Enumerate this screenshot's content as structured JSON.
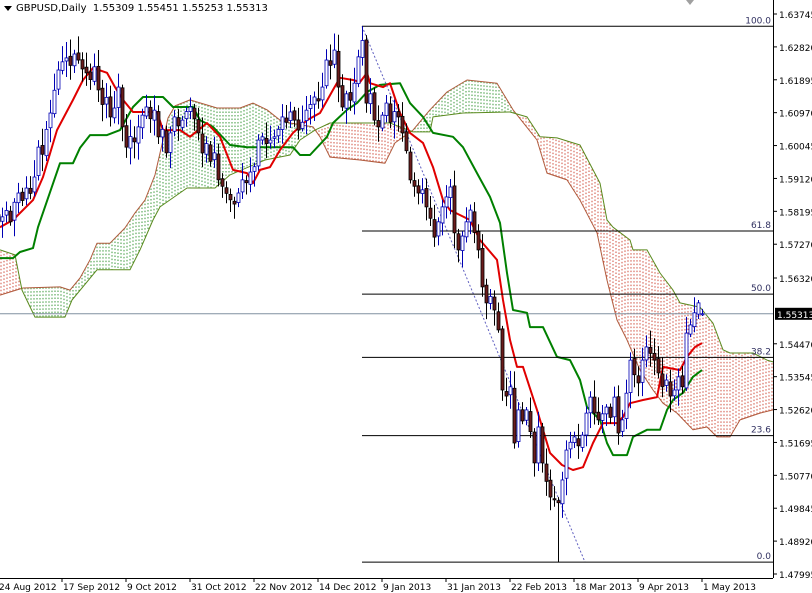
{
  "header": {
    "symbol": "GBPUSD,Daily",
    "open": "1.55309",
    "high": "1.55451",
    "low": "1.55253",
    "close": "1.55313"
  },
  "colors": {
    "bull_body": "#ffffff",
    "bull_line": "#0000b4",
    "bear_body": "#6b1c1c",
    "bear_line": "#000000",
    "tenkan": "#e00000",
    "kijun": "#008000",
    "cloud_bull": "#3c9a3c",
    "cloud_bear": "#d05040",
    "span_a": "#b05a3c",
    "span_b": "#5a8a1e",
    "fib": "#000000",
    "fib_trend": "#6060c0",
    "bid_line": "#8090a0"
  },
  "chart_data": {
    "type": "candlestick",
    "title": "GBPUSD,Daily",
    "ylim": [
      1.47995,
      1.63745
    ],
    "y_ticks": [
      "1.63745",
      "1.62820",
      "1.61895",
      "1.60970",
      "1.60045",
      "1.59120",
      "1.58195",
      "1.57270",
      "1.56320",
      "1.54470",
      "1.53545",
      "1.52620",
      "1.51695",
      "1.50770",
      "1.49845",
      "1.48920",
      "1.47995"
    ],
    "current_price": "1.55313",
    "x_ticks": [
      {
        "bar": 0,
        "label": "24 Aug 2012"
      },
      {
        "bar": 16,
        "label": "17 Sep 2012"
      },
      {
        "bar": 32,
        "label": "9 Oct 2012"
      },
      {
        "bar": 48,
        "label": "31 Oct 2012"
      },
      {
        "bar": 64,
        "label": "22 Nov 2012"
      },
      {
        "bar": 80,
        "label": "14 Dec 2012"
      },
      {
        "bar": 96,
        "label": "9 Jan 2013"
      },
      {
        "bar": 112,
        "label": "31 Jan 2013"
      },
      {
        "bar": 128,
        "label": "22 Feb 2013"
      },
      {
        "bar": 144,
        "label": "18 Mar 2013"
      },
      {
        "bar": 160,
        "label": "9 Apr 2013"
      },
      {
        "bar": 176,
        "label": "1 May 2013"
      }
    ],
    "closes": [
      1.579,
      1.5804,
      1.5822,
      1.579,
      1.5845,
      1.5871,
      1.585,
      1.5885,
      1.587,
      1.5916,
      1.6,
      1.598,
      1.605,
      1.6096,
      1.616,
      1.6217,
      1.624,
      1.6251,
      1.623,
      1.6262,
      1.6245,
      1.622,
      1.6209,
      1.619,
      1.6226,
      1.6161,
      1.612,
      1.614,
      1.6085,
      1.611,
      1.6169,
      1.6057,
      1.6,
      1.603,
      1.6015,
      1.6057,
      1.609,
      1.6113,
      1.608,
      1.6104,
      1.6029,
      1.605,
      1.5984,
      1.604,
      1.6085,
      1.606,
      1.6076,
      1.61,
      1.6113,
      1.608,
      1.604,
      1.5984,
      1.601,
      1.596,
      1.5984,
      1.5908,
      1.589,
      1.587,
      1.5852,
      1.584,
      1.5871,
      1.5908,
      1.59,
      1.593,
      1.5945,
      1.602,
      1.6029,
      1.601,
      1.602,
      1.6029,
      1.605,
      1.6085,
      1.607,
      1.6099,
      1.6076,
      1.6048,
      1.607,
      1.6104,
      1.612,
      1.6141,
      1.613,
      1.6169,
      1.6245,
      1.623,
      1.6273,
      1.6169,
      1.6113,
      1.615,
      1.6132,
      1.618,
      1.6254,
      1.63,
      1.6124,
      1.615,
      1.6076,
      1.6057,
      1.609,
      1.6124,
      1.607,
      1.61,
      1.6085,
      1.604,
      1.599,
      1.5908,
      1.589,
      1.5871,
      1.588,
      1.5832,
      1.58,
      1.5747,
      1.579,
      1.5832,
      1.586,
      1.5888,
      1.5759,
      1.5711,
      1.575,
      1.579,
      1.5823,
      1.576,
      1.5711,
      1.5607,
      1.5562,
      1.558,
      1.5542,
      1.5486,
      1.5317,
      1.53,
      1.5326,
      1.5168,
      1.5261,
      1.523,
      1.5261,
      1.52,
      1.5112,
      1.5213,
      1.5112,
      1.506,
      1.5016,
      1.5008,
      1.5,
      1.5064,
      1.5148,
      1.517,
      1.5185,
      1.516,
      1.519,
      1.5252,
      1.5297,
      1.5252,
      1.5233,
      1.525,
      1.5269,
      1.524,
      1.5297,
      1.5196,
      1.5233,
      1.5308,
      1.5401,
      1.536,
      1.5337,
      1.5401,
      1.5438,
      1.542,
      1.5401,
      1.5365,
      1.5326,
      1.5345,
      1.53,
      1.5317,
      1.5354,
      1.5326,
      1.5477,
      1.55,
      1.5534,
      1.5562,
      1.5531
    ],
    "last_bar_ohlc": [
      1.55309,
      1.55451,
      1.55253,
      1.55313
    ],
    "swing_high": {
      "bar": 91,
      "price": 1.634
    },
    "swing_low": {
      "bar": 140,
      "price": 1.4833
    },
    "fibonacci": {
      "levels": [
        0.0,
        23.6,
        38.2,
        50.0,
        61.8,
        100.0
      ],
      "labels": [
        "0.0",
        "23.6",
        "38.2",
        "50.0",
        "61.8",
        "100.0"
      ]
    },
    "tenkan_sen": [
      [
        0.5,
        1.5775
      ],
      [
        3.75,
        1.5795
      ],
      [
        8.75,
        1.5851
      ],
      [
        11.25,
        1.5916
      ],
      [
        14.75,
        1.6048
      ],
      [
        18.75,
        1.6133
      ],
      [
        21.25,
        1.6189
      ],
      [
        23.75,
        1.6223
      ],
      [
        27.25,
        1.6209
      ],
      [
        29.25,
        1.6169
      ],
      [
        31.25,
        1.6133
      ],
      [
        33.75,
        1.6099
      ],
      [
        39.75,
        1.6099
      ],
      [
        41.25,
        1.6048
      ],
      [
        45.5,
        1.6048
      ],
      [
        48,
        1.6029
      ],
      [
        52.25,
        1.6068
      ],
      [
        55.5,
        1.6029
      ],
      [
        58.75,
        1.5936
      ],
      [
        62.25,
        1.5927
      ],
      [
        63.75,
        1.5899
      ],
      [
        65.5,
        1.5936
      ],
      [
        68,
        1.5944
      ],
      [
        70.5,
        1.5992
      ],
      [
        73.75,
        1.604
      ],
      [
        77.25,
        1.6076
      ],
      [
        80.5,
        1.6096
      ],
      [
        83.75,
        1.6161
      ],
      [
        85.5,
        1.6195
      ],
      [
        88.75,
        1.6189
      ],
      [
        90.5,
        1.6183
      ],
      [
        92.25,
        1.6209
      ],
      [
        93,
        1.618
      ],
      [
        96.25,
        1.6169
      ],
      [
        98,
        1.618
      ],
      [
        100.5,
        1.6096
      ],
      [
        103,
        1.604
      ],
      [
        106.25,
        1.6012
      ],
      [
        108.75,
        1.5944
      ],
      [
        111.25,
        1.5851
      ],
      [
        113,
        1.5823
      ],
      [
        118,
        1.5795
      ],
      [
        120.5,
        1.5739
      ],
      [
        124.75,
        1.5683
      ],
      [
        126.25,
        1.557
      ],
      [
        128,
        1.5458
      ],
      [
        129.75,
        1.5382
      ],
      [
        131.25,
        1.5382
      ],
      [
        134.75,
        1.5261
      ],
      [
        138,
        1.514
      ],
      [
        141,
        1.5106
      ],
      [
        143.75,
        1.5092
      ],
      [
        146.25,
        1.51
      ],
      [
        148.75,
        1.5168
      ],
      [
        151.25,
        1.5224
      ],
      [
        154.75,
        1.5224
      ],
      [
        156.25,
        1.5241
      ],
      [
        158,
        1.528
      ],
      [
        161.25,
        1.5289
      ],
      [
        164.75,
        1.5297
      ],
      [
        166.25,
        1.5382
      ],
      [
        170.5,
        1.5373
      ],
      [
        172.25,
        1.541
      ],
      [
        174.25,
        1.5438
      ],
      [
        176,
        1.5449
      ]
    ],
    "kijun_sen": [
      [
        0.5,
        1.5688
      ],
      [
        3.75,
        1.5688
      ],
      [
        5.5,
        1.5705
      ],
      [
        8.75,
        1.5716
      ],
      [
        10,
        1.5775
      ],
      [
        15.5,
        1.5955
      ],
      [
        18.75,
        1.5955
      ],
      [
        20.5,
        1.5998
      ],
      [
        23,
        1.6034
      ],
      [
        27.25,
        1.6034
      ],
      [
        30.5,
        1.6048
      ],
      [
        33.75,
        1.6113
      ],
      [
        36.25,
        1.6141
      ],
      [
        41.25,
        1.6141
      ],
      [
        43.75,
        1.6113
      ],
      [
        48.75,
        1.6113
      ],
      [
        50.5,
        1.6076
      ],
      [
        53.75,
        1.6057
      ],
      [
        58,
        1.6006
      ],
      [
        62.25,
        1.6
      ],
      [
        73.75,
        1.6
      ],
      [
        75.5,
        1.5978
      ],
      [
        78,
        1.5978
      ],
      [
        82.25,
        1.6029
      ],
      [
        83.75,
        1.6068
      ],
      [
        87.25,
        1.6105
      ],
      [
        89.75,
        1.6124
      ],
      [
        92.25,
        1.6155
      ],
      [
        95.5,
        1.6175
      ],
      [
        100.5,
        1.618
      ],
      [
        103,
        1.6124
      ],
      [
        106.25,
        1.6085
      ],
      [
        108.75,
        1.604
      ],
      [
        113.75,
        1.6029
      ],
      [
        116.25,
        1.6
      ],
      [
        119.75,
        1.5927
      ],
      [
        123,
        1.586
      ],
      [
        125.5,
        1.5787
      ],
      [
        127.25,
        1.5646
      ],
      [
        128.75,
        1.5542
      ],
      [
        132.25,
        1.5534
      ],
      [
        133,
        1.5494
      ],
      [
        136.25,
        1.5494
      ],
      [
        139.75,
        1.541
      ],
      [
        143,
        1.5401
      ],
      [
        145.5,
        1.5345
      ],
      [
        147.25,
        1.5269
      ],
      [
        150.5,
        1.5233
      ],
      [
        152.25,
        1.5168
      ],
      [
        153.75,
        1.5134
      ],
      [
        157.25,
        1.5134
      ],
      [
        158.75,
        1.5185
      ],
      [
        162.25,
        1.5205
      ],
      [
        165.5,
        1.5205
      ],
      [
        167.25,
        1.5261
      ],
      [
        168.75,
        1.5289
      ],
      [
        171.25,
        1.5309
      ],
      [
        173.75,
        1.5354
      ],
      [
        176,
        1.5373
      ]
    ],
    "senkou_span_a": [
      [
        0.5,
        1.5584
      ],
      [
        6.25,
        1.5604
      ],
      [
        15.5,
        1.5607
      ],
      [
        18,
        1.5598
      ],
      [
        20.5,
        1.5632
      ],
      [
        23,
        1.5683
      ],
      [
        24.75,
        1.573
      ],
      [
        28,
        1.573
      ],
      [
        31.75,
        1.5773
      ],
      [
        34.25,
        1.5815
      ],
      [
        36.75,
        1.5851
      ],
      [
        39.25,
        1.5922
      ],
      [
        41.25,
        1.602
      ],
      [
        42.5,
        1.6082
      ],
      [
        44.25,
        1.6116
      ],
      [
        48,
        1.6133
      ],
      [
        54.75,
        1.611
      ],
      [
        60.5,
        1.611
      ],
      [
        63.75,
        1.6124
      ],
      [
        67.25,
        1.6105
      ],
      [
        70.5,
        1.6076
      ],
      [
        73,
        1.6068
      ],
      [
        78.75,
        1.6057
      ],
      [
        80.5,
        1.6029
      ],
      [
        83,
        1.5972
      ],
      [
        90.5,
        1.5964
      ],
      [
        96.75,
        1.5955
      ],
      [
        99.25,
        1.6012
      ],
      [
        103.75,
        1.6048
      ],
      [
        108,
        1.6105
      ],
      [
        112.25,
        1.6155
      ],
      [
        117.25,
        1.6189
      ],
      [
        124.75,
        1.618
      ],
      [
        128.75,
        1.6105
      ],
      [
        134.75,
        1.602
      ],
      [
        137.25,
        1.5927
      ],
      [
        142.25,
        1.5908
      ],
      [
        145.5,
        1.5851
      ],
      [
        149.75,
        1.5759
      ],
      [
        152.25,
        1.5626
      ],
      [
        154.75,
        1.5514
      ],
      [
        157.25,
        1.5458
      ],
      [
        160.5,
        1.5373
      ],
      [
        163.75,
        1.5317
      ],
      [
        166.25,
        1.528
      ],
      [
        169.75,
        1.5252
      ],
      [
        173.75,
        1.5205
      ],
      [
        177.25,
        1.5213
      ],
      [
        179.75,
        1.5185
      ],
      [
        183,
        1.5185
      ],
      [
        185.5,
        1.5233
      ],
      [
        190.5,
        1.5252
      ],
      [
        193.75,
        1.5261
      ]
    ],
    "senkou_span_b": [
      [
        0.5,
        1.5711
      ],
      [
        4.25,
        1.5697
      ],
      [
        6,
        1.5598
      ],
      [
        9.25,
        1.5522
      ],
      [
        16.75,
        1.5522
      ],
      [
        18.5,
        1.557
      ],
      [
        24.75,
        1.5655
      ],
      [
        33,
        1.5655
      ],
      [
        35.5,
        1.5711
      ],
      [
        38.75,
        1.5795
      ],
      [
        40.5,
        1.5832
      ],
      [
        47.25,
        1.5885
      ],
      [
        54.25,
        1.5885
      ],
      [
        58,
        1.5922
      ],
      [
        66.75,
        1.5964
      ],
      [
        73,
        1.5978
      ],
      [
        75.5,
        1.602
      ],
      [
        79.25,
        1.6048
      ],
      [
        83,
        1.6068
      ],
      [
        98,
        1.6068
      ],
      [
        103.75,
        1.6043
      ],
      [
        108,
        1.6043
      ],
      [
        108.75,
        1.6085
      ],
      [
        116.25,
        1.6096
      ],
      [
        128,
        1.6099
      ],
      [
        132.25,
        1.6085
      ],
      [
        135.5,
        1.6029
      ],
      [
        139.75,
        1.6026
      ],
      [
        145.5,
        1.6006
      ],
      [
        150.5,
        1.5899
      ],
      [
        152.25,
        1.5795
      ],
      [
        153.75,
        1.5775
      ],
      [
        158,
        1.5739
      ],
      [
        158.75,
        1.5711
      ],
      [
        162.25,
        1.5711
      ],
      [
        165.5,
        1.5646
      ],
      [
        168.75,
        1.5598
      ],
      [
        170.5,
        1.5562
      ],
      [
        175.5,
        1.555
      ],
      [
        178.75,
        1.5505
      ],
      [
        181.25,
        1.543
      ],
      [
        183,
        1.5421
      ],
      [
        188.75,
        1.5421
      ],
      [
        192.25,
        1.5401
      ],
      [
        193.75,
        1.5396
      ]
    ]
  }
}
